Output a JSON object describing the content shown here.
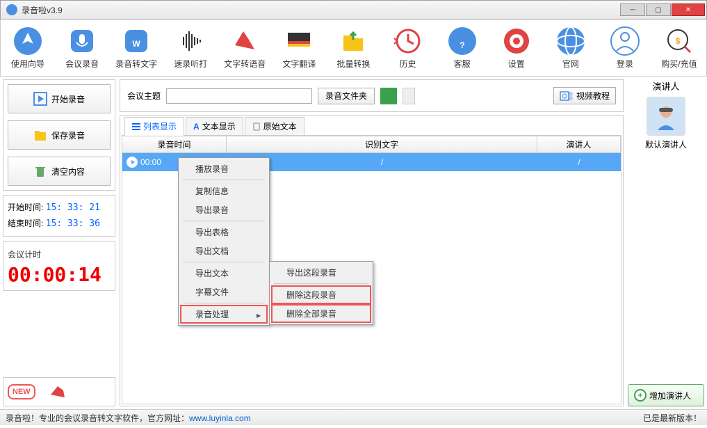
{
  "window": {
    "title": "录音啦v3.9"
  },
  "toolbar": [
    {
      "name": "guide",
      "label": "使用向导"
    },
    {
      "name": "meeting-record",
      "label": "会议录音"
    },
    {
      "name": "rec-to-text",
      "label": "录音转文字"
    },
    {
      "name": "fast-type",
      "label": "速录听打"
    },
    {
      "name": "text-to-speech",
      "label": "文字转语音"
    },
    {
      "name": "translate",
      "label": "文字翻译"
    },
    {
      "name": "batch",
      "label": "批量转换"
    },
    {
      "name": "history",
      "label": "历史"
    },
    {
      "name": "support",
      "label": "客服"
    },
    {
      "name": "settings",
      "label": "设置"
    },
    {
      "name": "website",
      "label": "官网"
    },
    {
      "name": "login",
      "label": "登录"
    },
    {
      "name": "buy",
      "label": "购买/充值"
    }
  ],
  "left": {
    "start": "开始录音",
    "save": "保存录音",
    "clear": "清空内容",
    "start_time_label": "开始时间:",
    "start_time": "15: 33: 21",
    "end_time_label": "结束时间:",
    "end_time": "15: 33: 36",
    "timer_label": "会议计时",
    "timer": "00:00:14",
    "new": "NEW"
  },
  "center": {
    "topic_label": "会议主题",
    "topic_value": "",
    "folder_btn": "录音文件夹",
    "video_btn": "视频教程",
    "tabs": [
      {
        "label": "列表显示"
      },
      {
        "label": "文本显示"
      },
      {
        "label": "原始文本"
      }
    ],
    "headers": {
      "time": "录音时间",
      "text": "识别文字",
      "speaker": "演讲人"
    },
    "row": {
      "time": "00:00",
      "text": "/",
      "speaker": "/"
    }
  },
  "right": {
    "title": "演讲人",
    "default": "默认演讲人",
    "add": "增加演讲人"
  },
  "context_menu": {
    "items": [
      "播放录音",
      "复制信息",
      "导出录音",
      "导出表格",
      "导出文档",
      "导出文本",
      "字幕文件",
      "录音处理"
    ],
    "submenu": [
      "导出这段录音",
      "删除这段录音",
      "删除全部录音"
    ]
  },
  "footer": {
    "left_a": "录音啦！专业的会议录音转文字软件，官方网址：",
    "url": "www.luyinla.com",
    "right": "已是最新版本！"
  }
}
